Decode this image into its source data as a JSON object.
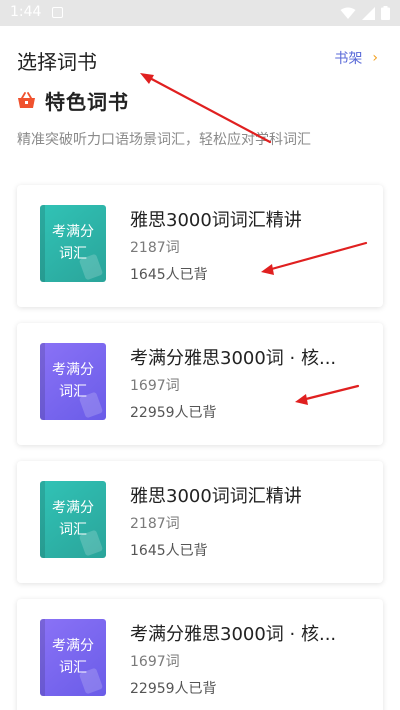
{
  "status_bar": {
    "time": "1:44"
  },
  "header": {
    "title": "选择词书",
    "shelf_label": "书架"
  },
  "feature": {
    "title": "特色词书",
    "description": "精准突破听力口语场景词汇，轻松应对学科词汇"
  },
  "books": [
    {
      "name": "雅思3000词词汇精讲",
      "word_count": "2187词",
      "learners": "1645人已背",
      "cover_line1": "考满分",
      "cover_line2": "词汇",
      "cover_color": "teal"
    },
    {
      "name": "考满分雅思3000词 · 核...",
      "word_count": "1697词",
      "learners": "22959人已背",
      "cover_line1": "考满分",
      "cover_line2": "词汇",
      "cover_color": "purple"
    },
    {
      "name": "雅思3000词词汇精讲",
      "word_count": "2187词",
      "learners": "1645人已背",
      "cover_line1": "考满分",
      "cover_line2": "词汇",
      "cover_color": "teal"
    },
    {
      "name": "考满分雅思3000词 · 核...",
      "word_count": "1697词",
      "learners": "22959人已背",
      "cover_line1": "考满分",
      "cover_line2": "词汇",
      "cover_color": "purple"
    }
  ],
  "colors": {
    "accent": "#5a6ad8",
    "chevron": "#f2a01e",
    "basket": "#f0522e",
    "annotation_arrow": "#e02020"
  }
}
